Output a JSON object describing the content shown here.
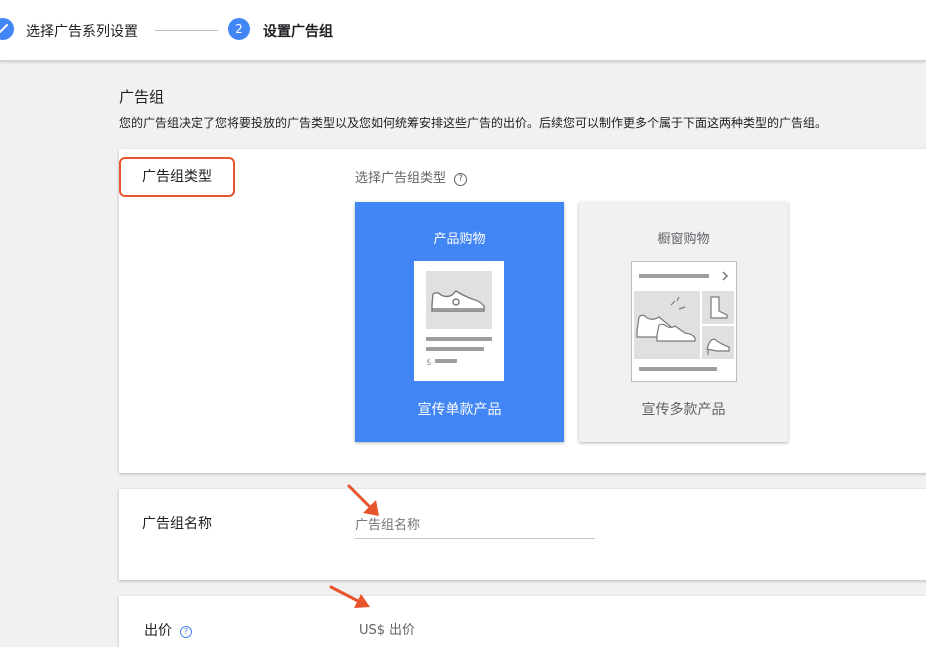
{
  "stepper": {
    "step1": {
      "label": "选择广告系列设置",
      "state": "done"
    },
    "step2": {
      "number": "2",
      "label": "设置广告组"
    }
  },
  "section": {
    "title": "广告组",
    "description": "您的广告组决定了您将要投放的广告类型以及您如何统筹安排这些广告的出价。后续您可以制作更多个属于下面这两种类型的广告组。"
  },
  "ad_group_type": {
    "label": "广告组类型",
    "hint": "选择广告组类型",
    "help_icon": "?",
    "options": [
      {
        "title": "产品购物",
        "caption": "宣传单款产品",
        "selected": true
      },
      {
        "title": "橱窗购物",
        "caption": "宣传多款产品",
        "selected": false
      }
    ],
    "product_price_symbol": "$"
  },
  "ad_group_name": {
    "label": "广告组名称",
    "placeholder": "广告组名称",
    "value": ""
  },
  "bid": {
    "label": "出价",
    "help_icon": "?",
    "currency": "US$",
    "placeholder": "出价",
    "value": ""
  },
  "colors": {
    "accent": "#4285f4",
    "annotation": "#e8542c",
    "page_bg": "#f1f1f1"
  },
  "icons": [
    "check-icon",
    "help-icon",
    "sneaker-icon",
    "boot-icon",
    "heel-icon",
    "chevron-right-icon",
    "annotation-arrow-icon"
  ]
}
